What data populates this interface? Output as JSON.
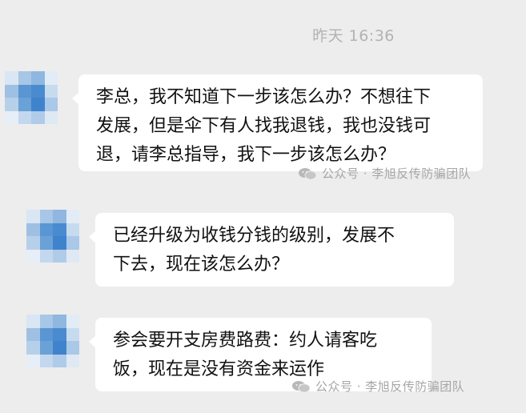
{
  "timestamp": "昨天 16:36",
  "messages": [
    {
      "text": "李总，我不知道下一步该怎么办？不想往下\n发展，但是伞下有人找我退钱，我也没钱可\n退，请李总指导，我下一步该怎么办？"
    },
    {
      "text": "已经升级为收钱分钱的级别，发展不\n下去，现在该怎么办？"
    },
    {
      "text": "参会要开支房费路费：约人请客吃\n饭，现在是没有资金来运作"
    }
  ],
  "watermark": "公众号 · 李旭反传防骗团队",
  "icons": {
    "avatar": "pixelated-avatar",
    "watermark_icon": "wechat-official-account-icon"
  },
  "colors": {
    "background": "#ededed",
    "bubble": "#ffffff",
    "text": "#111111",
    "timestamp": "#b2b2b2",
    "watermark": "#a6a6a6"
  }
}
